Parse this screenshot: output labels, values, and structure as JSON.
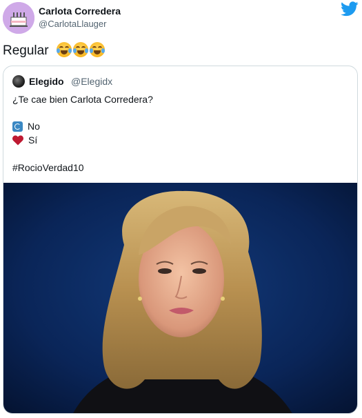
{
  "tweet": {
    "author_name": "Carlota Corredera",
    "author_handle": "@CarlotaLlauger",
    "text": "Regular",
    "emoji": [
      "face-with-tears-of-joy",
      "face-with-tears-of-joy",
      "face-with-tears-of-joy"
    ]
  },
  "quoted_tweet": {
    "author_name": "Elegido",
    "author_handle": "@Elegidx",
    "question": "¿Te cae bien Carlota Corredera?",
    "options": [
      {
        "icon": "repeat-icon",
        "label": "No"
      },
      {
        "icon": "heart-icon",
        "label": "Sí"
      }
    ],
    "hashtag": "#RocioVerdad10"
  },
  "colors": {
    "twitter_blue": "#1d9bf0",
    "handle_gray": "#536471",
    "photo_background": "#0a1e48"
  }
}
